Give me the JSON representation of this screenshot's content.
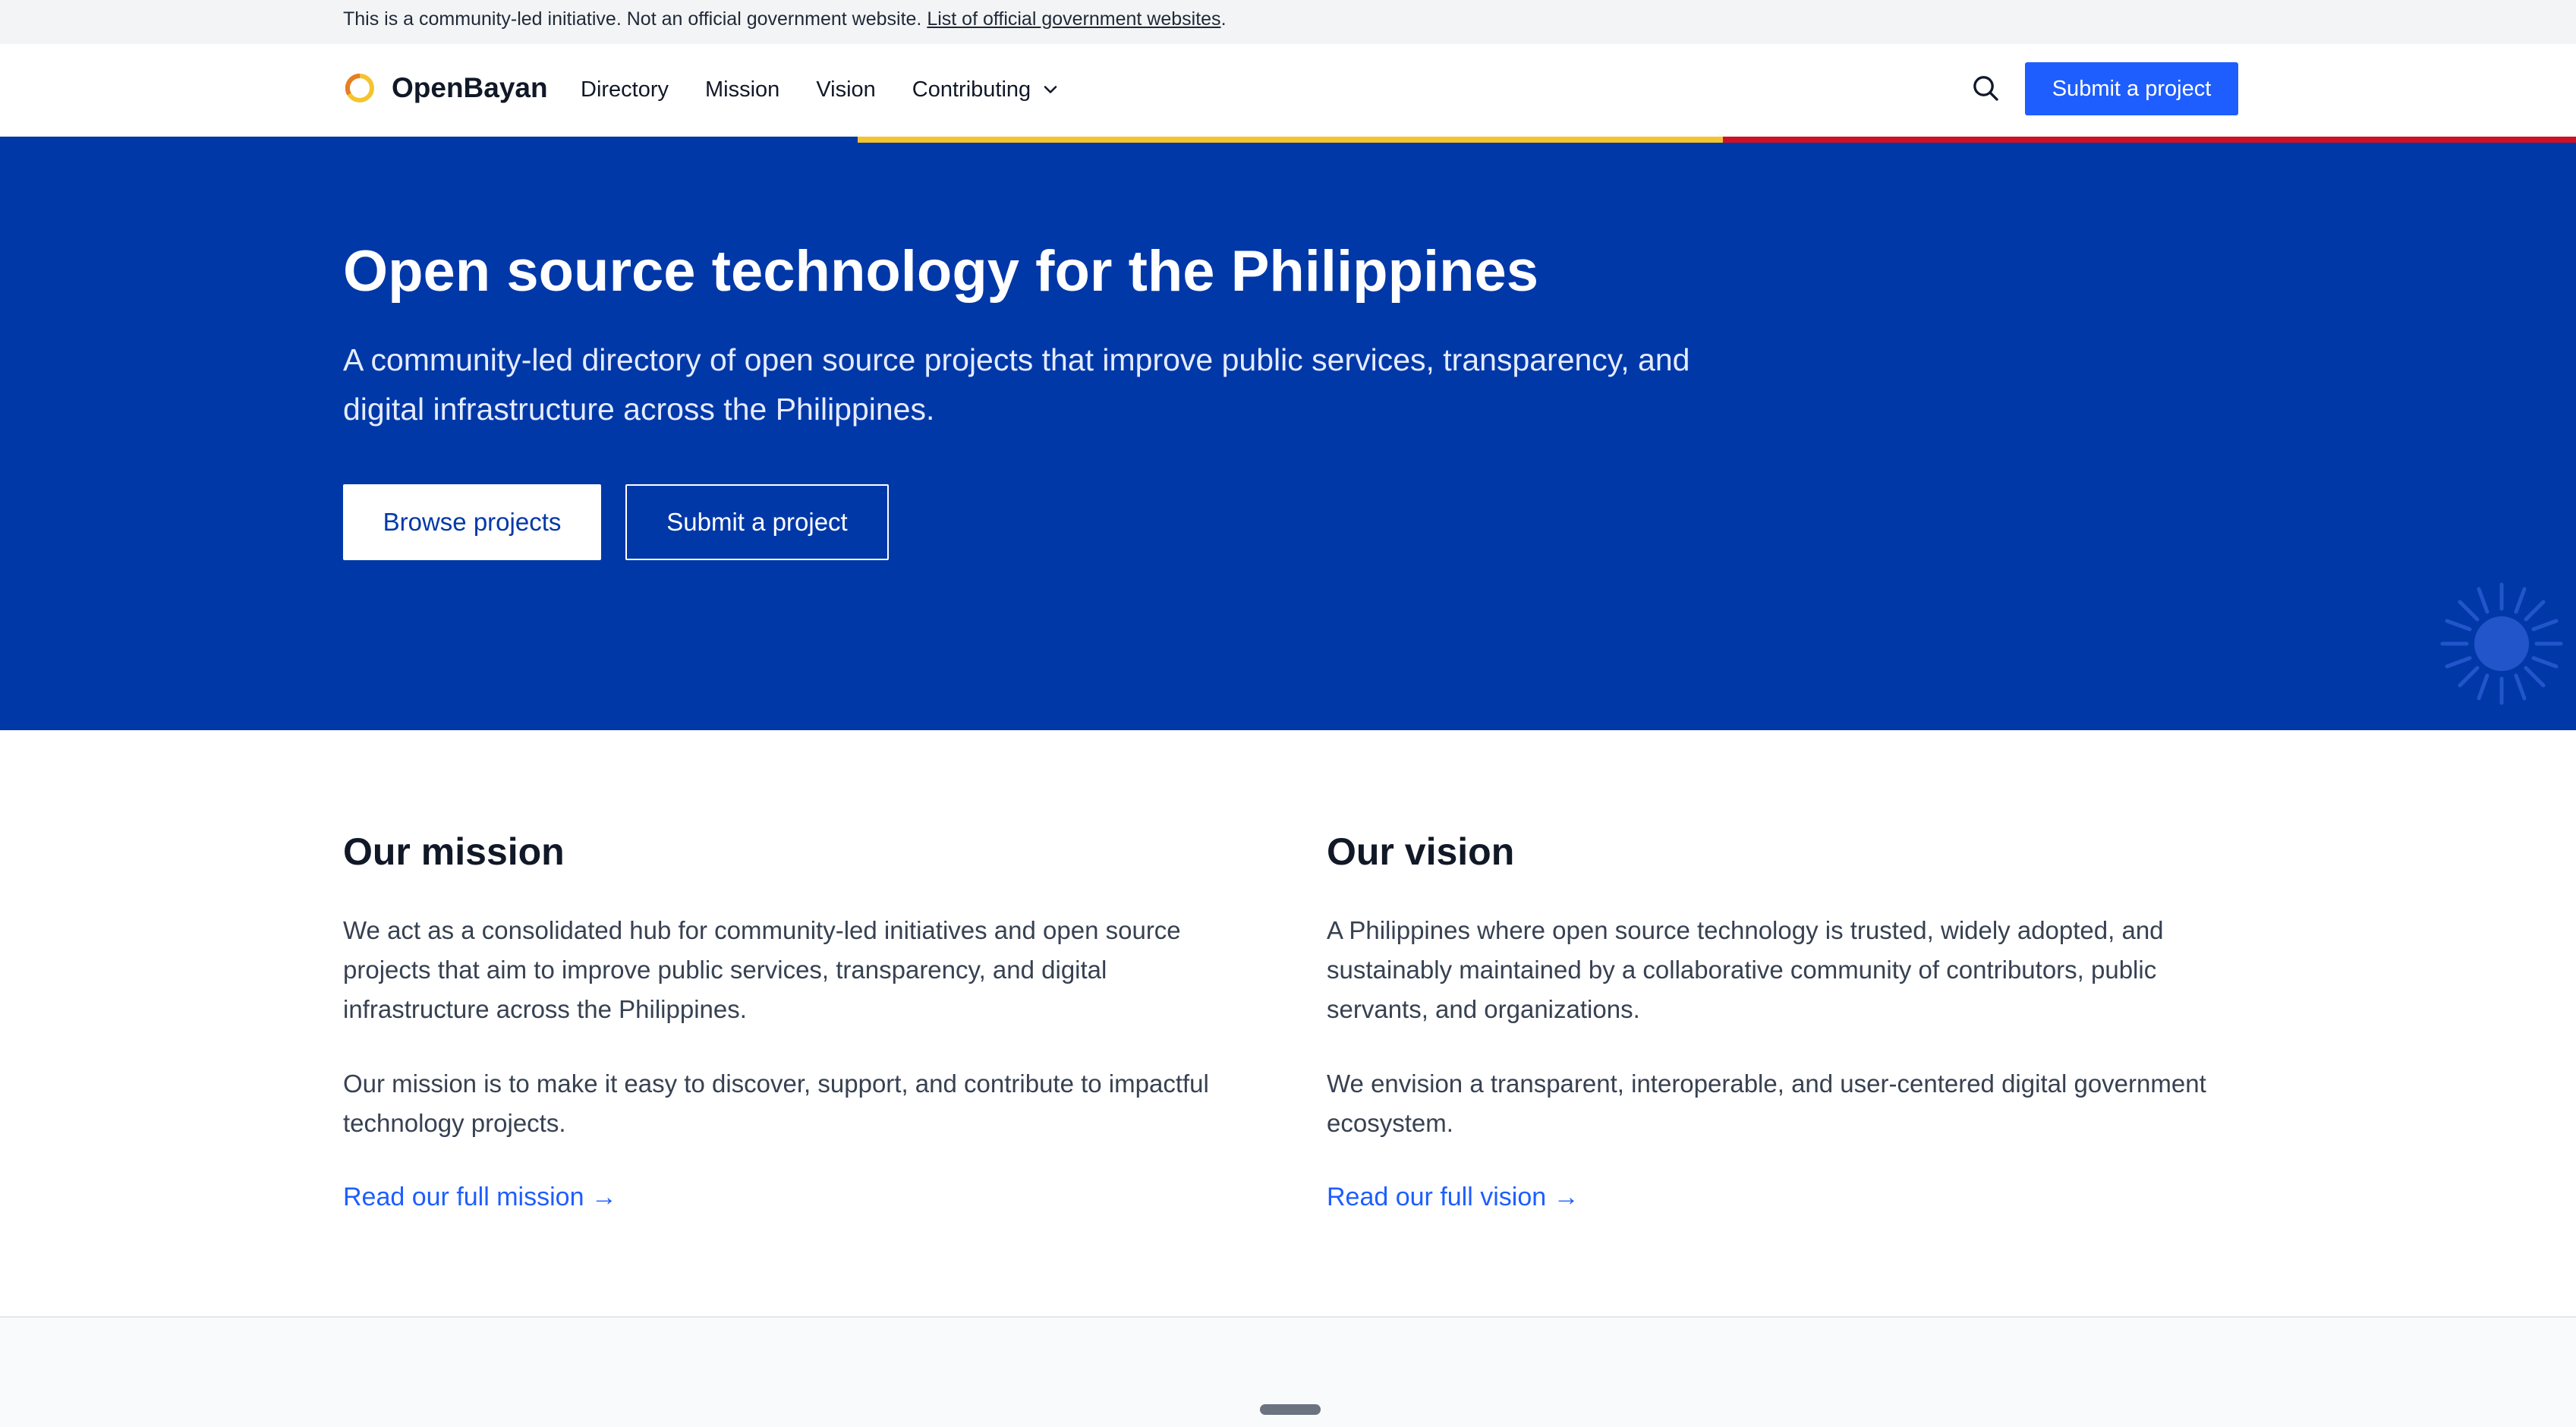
{
  "notice": {
    "text": "This is a community-led initiative. Not an official government website.",
    "link_label": "List of official government websites",
    "suffix": "."
  },
  "header": {
    "brand": "OpenBayan",
    "nav": [
      "Directory",
      "Mission",
      "Vision",
      "Contributing"
    ],
    "cta_label": "Submit a project"
  },
  "hero": {
    "title": "Open source technology for the Philippines",
    "subtitle": "A community-led directory of open source projects that improve public services, transparency, and digital infrastructure across the Philippines.",
    "primary_button": "Browse projects",
    "secondary_button": "Submit a project"
  },
  "mission": {
    "heading": "Our mission",
    "p1": "We act as a consolidated hub for community-led initiatives and open source projects that aim to improve public services, transparency, and digital infrastructure across the Philippines.",
    "p2": "Our mission is to make it easy to discover, support, and contribute to impactful technology projects.",
    "link": "Read our full mission →"
  },
  "vision": {
    "heading": "Our vision",
    "p1": "A Philippines where open source technology is trusted, widely adopted, and sustainably maintained by a collaborative community of contributors, public servants, and organizations.",
    "p2": "We envision a transparent, interoperable, and user-centered digital government ecosystem.",
    "link": "Read our full vision →"
  },
  "colors": {
    "hero_blue": "#0038a8",
    "accent_blue": "#1e5eff",
    "flag_yellow": "#f4c430",
    "flag_red": "#ce1126"
  },
  "icons": {
    "logo": "openbayan-ring-logo",
    "search": "search-icon",
    "chevron": "chevron-down-icon",
    "sun": "philippine-sun-icon"
  }
}
